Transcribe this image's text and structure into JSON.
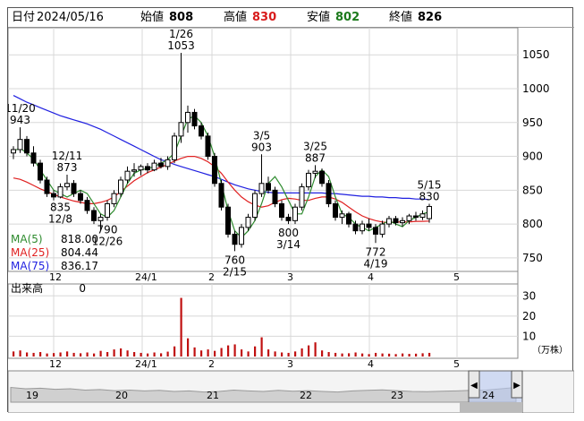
{
  "ohlc_bar": {
    "date_label": "日付",
    "date": "2024/05/16",
    "open_label": "始値",
    "open": "808",
    "high_label": "高値",
    "high": "830",
    "low_label": "安値",
    "low": "802",
    "close_label": "終値",
    "close": "826"
  },
  "colors": {
    "up": "#d81b1b",
    "down": "#1b7a1b",
    "ma5": "#2e8b2e",
    "ma25": "#e02020",
    "ma75": "#2020e0",
    "volume": "#c01010"
  },
  "ma_legend": [
    {
      "name": "MA(5)",
      "value": "818.00",
      "color": "#2e8b2e"
    },
    {
      "name": "MA(25)",
      "value": "804.44",
      "color": "#e02020"
    },
    {
      "name": "MA(75)",
      "value": "836.17",
      "color": "#2020e0"
    }
  ],
  "volume_label": {
    "name": "出来高",
    "value": "0",
    "unit": "（万株）"
  },
  "nav": {
    "left_arrow": "◀",
    "right_arrow": "▶",
    "years": [
      "19",
      "20",
      "21",
      "22",
      "23",
      "24"
    ]
  },
  "chart_data": {
    "type": "candlestick",
    "price_axis": {
      "ylim": [
        730,
        1090
      ],
      "ticks": [
        750,
        800,
        850,
        900,
        950,
        1000,
        1050
      ]
    },
    "volume_axis": {
      "ylim": [
        0,
        35
      ],
      "ticks": [
        10,
        20,
        30
      ]
    },
    "x_ticks": [
      "12",
      "24/1",
      "2",
      "3",
      "4",
      "5"
    ],
    "annotations": [
      {
        "label": "11/20",
        "value": "943",
        "type": "high"
      },
      {
        "label": "12/11",
        "value": "873",
        "type": "high"
      },
      {
        "label": "835",
        "date": "12/8",
        "type": "low"
      },
      {
        "label": "790",
        "date": "12/26",
        "type": "low"
      },
      {
        "label": "1/26",
        "value": "1053",
        "type": "high"
      },
      {
        "label": "760",
        "date": "2/15",
        "type": "low"
      },
      {
        "label": "3/5",
        "value": "903",
        "type": "high"
      },
      {
        "label": "800",
        "date": "3/14",
        "type": "low"
      },
      {
        "label": "3/25",
        "value": "887",
        "type": "high"
      },
      {
        "label": "772",
        "date": "4/19",
        "type": "low"
      },
      {
        "label": "5/15",
        "value": "830",
        "type": "high"
      }
    ],
    "ma5": [
      908,
      912,
      905,
      896,
      880,
      865,
      850,
      845,
      840,
      845,
      850,
      845,
      830,
      815,
      810,
      820,
      840,
      860,
      875,
      880,
      882,
      885,
      890,
      895,
      905,
      930,
      955,
      960,
      950,
      930,
      900,
      860,
      820,
      790,
      780,
      790,
      805,
      830,
      860,
      870,
      855,
      835,
      815,
      815,
      840,
      870,
      880,
      870,
      840,
      815,
      810,
      800,
      795,
      790,
      795,
      800,
      805,
      800,
      796,
      805,
      810,
      815,
      818
    ],
    "ma25": [
      868,
      866,
      862,
      857,
      852,
      848,
      844,
      840,
      837,
      834,
      832,
      830,
      830,
      832,
      835,
      840,
      848,
      856,
      864,
      870,
      876,
      880,
      884,
      888,
      893,
      897,
      900,
      900,
      897,
      892,
      885,
      875,
      862,
      850,
      840,
      833,
      828,
      825,
      827,
      832,
      836,
      838,
      837,
      835,
      835,
      838,
      840,
      840,
      837,
      832,
      825,
      818,
      812,
      808,
      805,
      803,
      802,
      803,
      803,
      803,
      804,
      804,
      804.44
    ],
    "ma75": [
      990,
      985,
      980,
      976,
      972,
      968,
      964,
      960,
      957,
      954,
      951,
      948,
      944,
      940,
      935,
      930,
      925,
      920,
      915,
      910,
      905,
      900,
      895,
      892,
      888,
      885,
      882,
      879,
      876,
      873,
      870,
      866,
      862,
      858,
      855,
      852,
      850,
      848,
      847,
      846,
      846,
      846,
      846,
      846,
      846,
      846,
      846,
      845,
      845,
      844,
      843,
      842,
      841,
      841,
      840,
      840,
      839,
      839,
      838,
      838,
      837,
      837,
      836.17
    ],
    "candles": [
      {
        "o": 905,
        "h": 915,
        "l": 896,
        "c": 910
      },
      {
        "o": 910,
        "h": 943,
        "l": 905,
        "c": 925
      },
      {
        "o": 925,
        "h": 930,
        "l": 900,
        "c": 905
      },
      {
        "o": 905,
        "h": 915,
        "l": 885,
        "c": 890
      },
      {
        "o": 890,
        "h": 895,
        "l": 860,
        "c": 865
      },
      {
        "o": 865,
        "h": 870,
        "l": 840,
        "c": 845
      },
      {
        "o": 845,
        "h": 850,
        "l": 835,
        "c": 840
      },
      {
        "o": 840,
        "h": 860,
        "l": 838,
        "c": 855
      },
      {
        "o": 855,
        "h": 873,
        "l": 850,
        "c": 860
      },
      {
        "o": 860,
        "h": 865,
        "l": 840,
        "c": 845
      },
      {
        "o": 845,
        "h": 850,
        "l": 830,
        "c": 835
      },
      {
        "o": 835,
        "h": 840,
        "l": 815,
        "c": 820
      },
      {
        "o": 820,
        "h": 825,
        "l": 800,
        "c": 805
      },
      {
        "o": 805,
        "h": 815,
        "l": 790,
        "c": 810
      },
      {
        "o": 810,
        "h": 835,
        "l": 805,
        "c": 830
      },
      {
        "o": 830,
        "h": 850,
        "l": 825,
        "c": 845
      },
      {
        "o": 845,
        "h": 870,
        "l": 840,
        "c": 865
      },
      {
        "o": 865,
        "h": 885,
        "l": 860,
        "c": 878
      },
      {
        "o": 878,
        "h": 890,
        "l": 870,
        "c": 880
      },
      {
        "o": 880,
        "h": 888,
        "l": 872,
        "c": 885
      },
      {
        "o": 885,
        "h": 890,
        "l": 875,
        "c": 880
      },
      {
        "o": 880,
        "h": 895,
        "l": 878,
        "c": 890
      },
      {
        "o": 890,
        "h": 898,
        "l": 882,
        "c": 885
      },
      {
        "o": 885,
        "h": 900,
        "l": 880,
        "c": 895
      },
      {
        "o": 895,
        "h": 935,
        "l": 890,
        "c": 930
      },
      {
        "o": 930,
        "h": 1053,
        "l": 920,
        "c": 950
      },
      {
        "o": 950,
        "h": 975,
        "l": 935,
        "c": 965
      },
      {
        "o": 965,
        "h": 970,
        "l": 940,
        "c": 945
      },
      {
        "o": 945,
        "h": 950,
        "l": 925,
        "c": 930
      },
      {
        "o": 930,
        "h": 935,
        "l": 895,
        "c": 900
      },
      {
        "o": 900,
        "h": 905,
        "l": 855,
        "c": 860
      },
      {
        "o": 860,
        "h": 865,
        "l": 820,
        "c": 825
      },
      {
        "o": 825,
        "h": 830,
        "l": 780,
        "c": 785
      },
      {
        "o": 785,
        "h": 790,
        "l": 760,
        "c": 770
      },
      {
        "o": 770,
        "h": 800,
        "l": 765,
        "c": 795
      },
      {
        "o": 795,
        "h": 815,
        "l": 790,
        "c": 810
      },
      {
        "o": 810,
        "h": 850,
        "l": 805,
        "c": 845
      },
      {
        "o": 845,
        "h": 903,
        "l": 840,
        "c": 860
      },
      {
        "o": 860,
        "h": 870,
        "l": 845,
        "c": 850
      },
      {
        "o": 850,
        "h": 855,
        "l": 825,
        "c": 830
      },
      {
        "o": 830,
        "h": 835,
        "l": 805,
        "c": 810
      },
      {
        "o": 810,
        "h": 815,
        "l": 800,
        "c": 805
      },
      {
        "o": 805,
        "h": 830,
        "l": 800,
        "c": 825
      },
      {
        "o": 825,
        "h": 860,
        "l": 820,
        "c": 855
      },
      {
        "o": 855,
        "h": 880,
        "l": 850,
        "c": 875
      },
      {
        "o": 875,
        "h": 887,
        "l": 868,
        "c": 878
      },
      {
        "o": 878,
        "h": 882,
        "l": 855,
        "c": 860
      },
      {
        "o": 860,
        "h": 865,
        "l": 825,
        "c": 830
      },
      {
        "o": 830,
        "h": 835,
        "l": 805,
        "c": 810
      },
      {
        "o": 810,
        "h": 820,
        "l": 800,
        "c": 815
      },
      {
        "o": 815,
        "h": 818,
        "l": 795,
        "c": 800
      },
      {
        "o": 800,
        "h": 805,
        "l": 785,
        "c": 790
      },
      {
        "o": 790,
        "h": 805,
        "l": 785,
        "c": 800
      },
      {
        "o": 800,
        "h": 808,
        "l": 790,
        "c": 795
      },
      {
        "o": 795,
        "h": 800,
        "l": 772,
        "c": 785
      },
      {
        "o": 785,
        "h": 805,
        "l": 780,
        "c": 800
      },
      {
        "o": 800,
        "h": 812,
        "l": 795,
        "c": 808
      },
      {
        "o": 808,
        "h": 812,
        "l": 798,
        "c": 802
      },
      {
        "o": 802,
        "h": 810,
        "l": 796,
        "c": 805
      },
      {
        "o": 805,
        "h": 815,
        "l": 800,
        "c": 812
      },
      {
        "o": 812,
        "h": 818,
        "l": 805,
        "c": 810
      },
      {
        "o": 810,
        "h": 820,
        "l": 806,
        "c": 815
      },
      {
        "o": 808,
        "h": 830,
        "l": 802,
        "c": 826
      }
    ],
    "volume": [
      2.5,
      3.0,
      2.0,
      1.8,
      2.2,
      1.5,
      1.7,
      2.0,
      2.5,
      1.8,
      1.6,
      2.0,
      1.5,
      2.8,
      2.2,
      3.5,
      4.0,
      3.0,
      2.2,
      1.8,
      1.5,
      2.0,
      1.6,
      2.4,
      5.0,
      29.0,
      9.0,
      4.5,
      3.0,
      3.5,
      2.8,
      4.2,
      5.5,
      6.0,
      3.5,
      2.5,
      5.0,
      9.5,
      3.5,
      2.5,
      2.0,
      1.8,
      2.5,
      4.0,
      5.5,
      7.0,
      3.0,
      2.2,
      1.8,
      1.5,
      1.6,
      2.0,
      1.5,
      1.2,
      1.8,
      1.5,
      1.4,
      1.2,
      1.5,
      1.3,
      1.4,
      1.6,
      1.8
    ],
    "overview": {
      "type": "area",
      "values": [
        0.55,
        0.5,
        0.52,
        0.48,
        0.5,
        0.45,
        0.47,
        0.43,
        0.45,
        0.42,
        0.44,
        0.4,
        0.42,
        0.38,
        0.4,
        0.45,
        0.42,
        0.4,
        0.44,
        0.41,
        0.43,
        0.4,
        0.38,
        0.42,
        0.44,
        0.46,
        0.43,
        0.4,
        0.39,
        0.41,
        0.42,
        0.44,
        0.45,
        0.5,
        0.55
      ]
    }
  }
}
